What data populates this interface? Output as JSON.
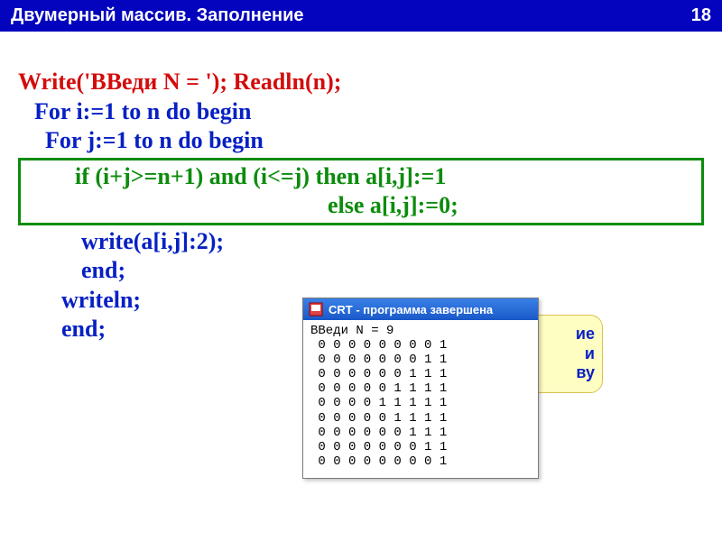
{
  "header": {
    "title": "Двумерный массив. Заполнение",
    "page_number": "18"
  },
  "code": {
    "line1_a": "Write('ВВеди N = '); ",
    "line1_b": "Readln(n);",
    "line2": "For i:=1 to n do begin",
    "line3": "For j:=1 to n do begin",
    "line4": "if (i+j>=n+1) and (i<=j) then a[i,j]:=1",
    "line5": "else a[i,j]:=0;",
    "line6": "write(a[i,j]:2);",
    "line7": "end;",
    "line8": "writeln;",
    "line9": "end;"
  },
  "note": {
    "l1": "ие",
    "l2": "и",
    "l3": "ву"
  },
  "crt": {
    "title": "CRT - программа завершена",
    "prompt": "ВВеди N = 9",
    "matrix": [
      [
        0,
        0,
        0,
        0,
        0,
        0,
        0,
        0,
        1
      ],
      [
        0,
        0,
        0,
        0,
        0,
        0,
        0,
        1,
        1
      ],
      [
        0,
        0,
        0,
        0,
        0,
        0,
        1,
        1,
        1
      ],
      [
        0,
        0,
        0,
        0,
        0,
        1,
        1,
        1,
        1
      ],
      [
        0,
        0,
        0,
        0,
        1,
        1,
        1,
        1,
        1
      ],
      [
        0,
        0,
        0,
        0,
        0,
        1,
        1,
        1,
        1
      ],
      [
        0,
        0,
        0,
        0,
        0,
        0,
        1,
        1,
        1
      ],
      [
        0,
        0,
        0,
        0,
        0,
        0,
        0,
        1,
        1
      ],
      [
        0,
        0,
        0,
        0,
        0,
        0,
        0,
        0,
        1
      ]
    ]
  }
}
